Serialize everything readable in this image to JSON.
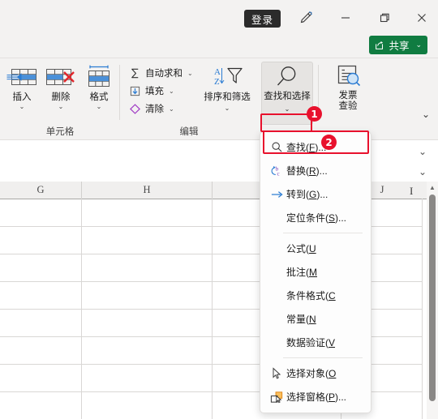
{
  "titlebar": {
    "signin_label": "登录",
    "pen_icon": "pen-draw-icon",
    "minimize_icon": "minimize-icon",
    "maximize_icon": "restore-icon",
    "close_icon": "close-icon"
  },
  "share": {
    "label": "共享",
    "caret": "⌄",
    "color": "#107c41"
  },
  "ribbon": {
    "cells_group": {
      "label": "单元格",
      "buttons": [
        {
          "label": "插入",
          "caret": "⌄",
          "icon": "insert-cells-icon"
        },
        {
          "label": "删除",
          "caret": "⌄",
          "icon": "delete-cells-icon"
        },
        {
          "label": "格式",
          "caret": "⌄",
          "icon": "format-cells-icon"
        }
      ]
    },
    "editing_group": {
      "label": "编辑",
      "small_buttons": [
        {
          "label": "自动求和",
          "caret": "⌄",
          "icon": "autosum-sigma-icon"
        },
        {
          "label": "填充",
          "caret": "⌄",
          "icon": "fill-down-icon"
        },
        {
          "label": "清除",
          "caret": "⌄",
          "icon": "clear-eraser-icon"
        }
      ],
      "sort_filter": {
        "label": "排序和筛选",
        "caret": "⌄",
        "icon": "sort-filter-icon"
      },
      "find_select": {
        "label": "查找和选择",
        "caret": "⌄",
        "icon": "magnifier-icon"
      }
    },
    "invoice_group": {
      "label_line1": "发票",
      "label_line2": "查验",
      "icon": "invoice-verify-icon"
    },
    "collapse_caret": "⌄"
  },
  "namebar": {
    "value": "",
    "caret": "⌄"
  },
  "formulabar": {
    "value": "",
    "caret": "⌄"
  },
  "sheet": {
    "columns": [
      "G",
      "H",
      "I",
      "J"
    ],
    "cursor_glyph": "I"
  },
  "scrollbar": {
    "up_arrow": "▲",
    "down_arrow": "▼"
  },
  "menu": {
    "items": [
      {
        "icon": "magnifier-icon",
        "text_a": "查找(",
        "key": "F",
        "text_b": ")..."
      },
      {
        "icon": "replace-bc-icon",
        "text_a": "替换(",
        "key": "R",
        "text_b": ")..."
      },
      {
        "icon": "goto-arrow-icon",
        "text_a": "转到(",
        "key": "G",
        "text_b": ")..."
      },
      {
        "icon": "none",
        "text_a": "定位条件(",
        "key": "S",
        "text_b": ")..."
      },
      {
        "separator": true
      },
      {
        "icon": "none",
        "text_a": "公式(",
        "key": "U",
        "text_b": ""
      },
      {
        "icon": "none",
        "text_a": "批注(",
        "key": "M",
        "text_b": ""
      },
      {
        "icon": "none",
        "text_a": "条件格式(",
        "key": "C",
        "text_b": ""
      },
      {
        "icon": "none",
        "text_a": "常量(",
        "key": "N",
        "text_b": ""
      },
      {
        "icon": "none",
        "text_a": "数据验证(",
        "key": "V",
        "text_b": ""
      },
      {
        "separator": true
      },
      {
        "icon": "select-object-cursor-icon",
        "text_a": "选择对象(",
        "key": "O",
        "text_b": ""
      },
      {
        "icon": "selection-pane-icon",
        "text_a": "选择窗格(",
        "key": "P",
        "text_b": ")..."
      }
    ]
  },
  "annotations": {
    "badge_1": "1",
    "badge_2": "2",
    "highlight_color": "#e8112d"
  }
}
